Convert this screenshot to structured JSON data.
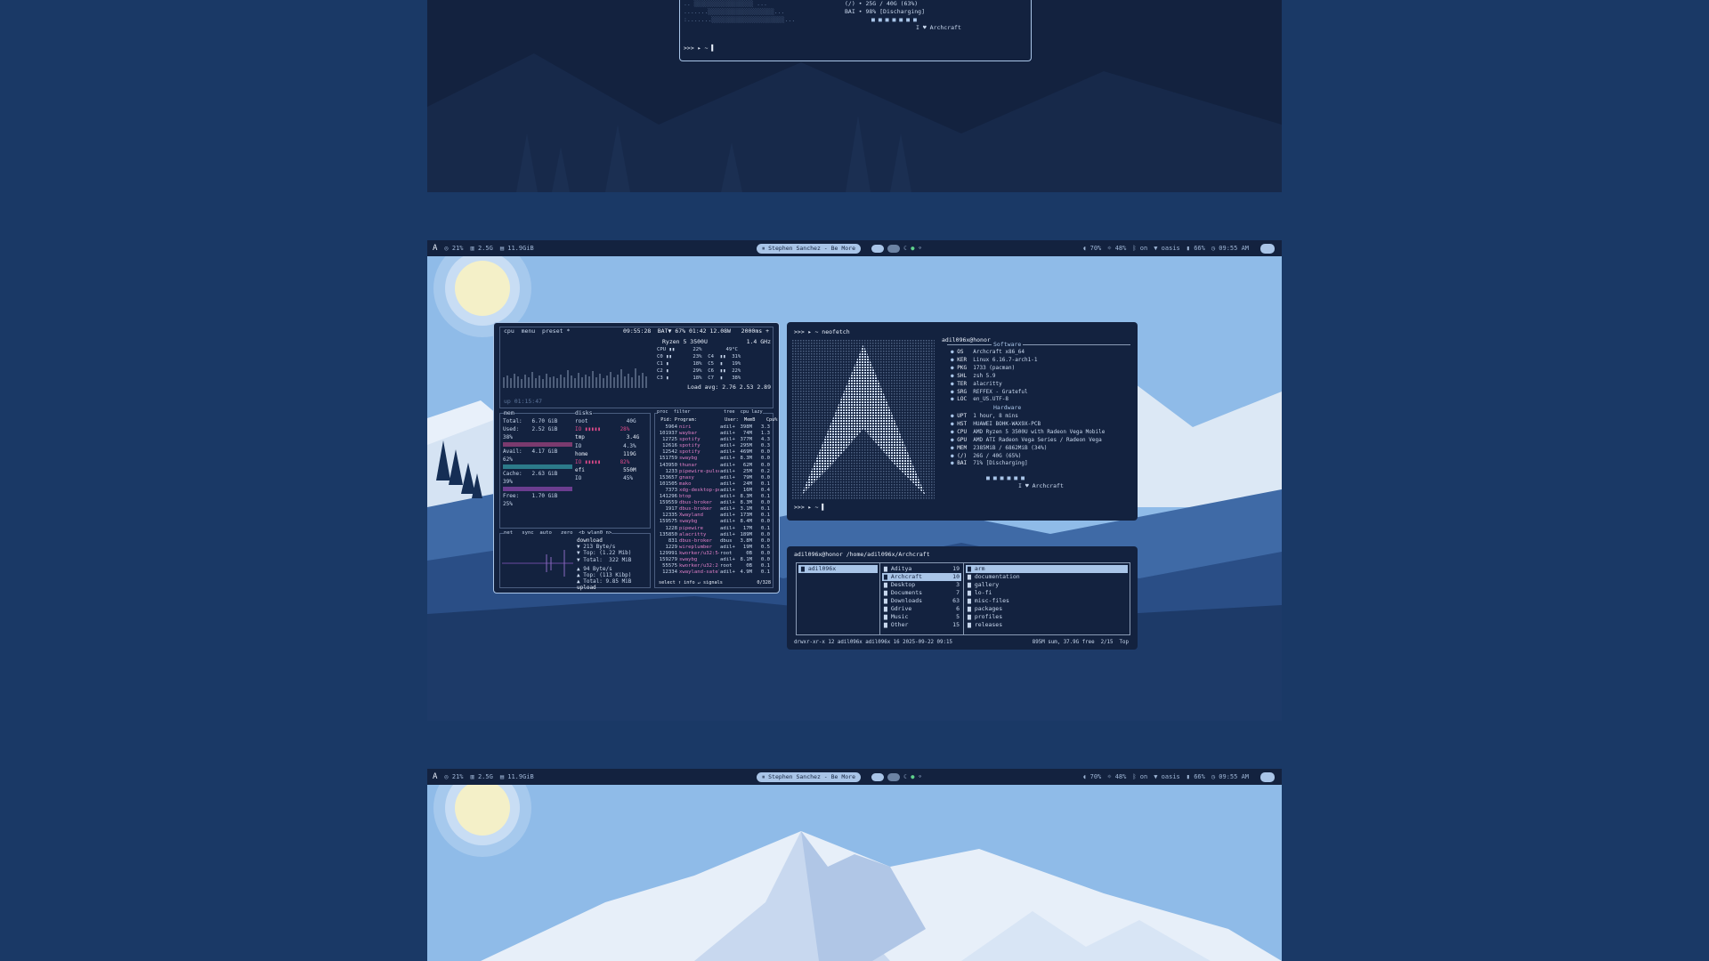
{
  "top_terminal": {
    "lines": [
      "(/) • 25G / 40G (63%)",
      "BAI • 98% [Discharging]",
      "I ♥ Archcraft"
    ],
    "prompt": ">>> ▸ ~ ▌"
  },
  "bar": {
    "logo": "A",
    "cpu": "21%",
    "disk": "2.5G",
    "mem": "11.9GiB",
    "media": "Stephen Sanchez - Be More",
    "volume": "70%",
    "brightness": "48%",
    "bluetooth": "on",
    "wifi": "oasis",
    "battery": "66%",
    "time": "09:55 AM"
  },
  "btop": {
    "header_left": "cpu  menu  preset *",
    "header_clock": "09:55:28",
    "header_right": "BAT▼ 67% 01:42 12.08W   2000ms +",
    "cpu_model": "Ryzen 5 3500U",
    "cpu_freq": "1.4 GHz",
    "cpu_lines": [
      "CPU ▮▮      22%        49°C",
      "C0 ▮▮       23%  C4  ▮▮  31%",
      "C1 ▮        18%  C5  ▮   19%",
      "C2 ▮        29%  C6  ▮▮  22%",
      "C3 ▮        18%  C7  ▮   38%"
    ],
    "load": "Load avg: 2.76 2.53 2.89",
    "uptime": "up 01:15:47",
    "mem_lines": [
      "Total:   6.70 GiB",
      "Used:    2.52 GiB",
      "38%",
      "Avail:   4.17 GiB",
      "62%",
      "Cache:   2.63 GiB",
      "39%",
      "Free:    1.70 GiB",
      "25%"
    ],
    "disk_lines": [
      "root            40G",
      "IO ▮▮▮▮▮      28%",
      "tmp             3.4G",
      "IO             4.3%",
      "home           119G",
      "IO ▮▮▮▮▮      82%",
      "efi            550M",
      "IO             45%"
    ],
    "net_lines": [
      "download",
      "▼ 213 Byte/s",
      "▼ Top: (1.22 Mib)",
      "▼ Total:  322 MiB",
      "▲ 94 Byte/s",
      "▲ Top: (113 Kibp)",
      "▲ Total: 9.85 MiB",
      "upload"
    ],
    "net_header": "net   sync  auto   zero  <b wlan0 n>",
    "proc_header": "proc  filter            tree  cpu lazy",
    "proc_cols": "  Pid: Program:          User:  MemB    Cpu%",
    "procs": [
      [
        "5964",
        "niri",
        "adil+",
        "398M",
        "3.3"
      ],
      [
        "101937",
        "waybar",
        "adil+",
        "74M",
        "1.3"
      ],
      [
        "12725",
        "spotify",
        "adil+",
        "377M",
        "4.3"
      ],
      [
        "12616",
        "spotify",
        "adil+",
        "295M",
        "0.3"
      ],
      [
        "12542",
        "spotify",
        "adil+",
        "469M",
        "0.0"
      ],
      [
        "151759",
        "swaybg",
        "adil+",
        "8.3M",
        "0.0"
      ],
      [
        "143950",
        "thunar",
        "adil+",
        "62M",
        "0.0"
      ],
      [
        "1233",
        "pipewire-pulse",
        "adil+",
        "25M",
        "0.2"
      ],
      [
        "153657",
        "gnasy",
        "adil+",
        "79M",
        "0.0"
      ],
      [
        "101505",
        "mako",
        "adil+",
        "24M",
        "0.1"
      ],
      [
        "7373",
        "xdg-desktop-por",
        "adil+",
        "16M",
        "0.4"
      ],
      [
        "141296",
        "btop",
        "adil+",
        "8.3M",
        "0.1"
      ],
      [
        "159559",
        "dbus-broker",
        "adil+",
        "8.3M",
        "0.0"
      ],
      [
        "1917",
        "dbus-broker",
        "adil+",
        "3.1M",
        "0.1"
      ],
      [
        "12335",
        "Xwayland",
        "adil+",
        "173M",
        "0.1"
      ],
      [
        "159575",
        "swaybg",
        "adil+",
        "8.4M",
        "0.0"
      ],
      [
        "1228",
        "pipewire",
        "adil+",
        "17M",
        "0.1"
      ],
      [
        "135850",
        "alacritty",
        "adil+",
        "189M",
        "0.0"
      ],
      [
        "831",
        "dbus-broker",
        "dbus",
        "3.8M",
        "0.0"
      ],
      [
        "1229",
        "wireplumber",
        "adil+",
        "19M",
        "0.5"
      ],
      [
        "129991",
        "kworker/u32:5+e",
        "root",
        "0B",
        "0.0"
      ],
      [
        "159279",
        "swaybg",
        "adil+",
        "8.1M",
        "0.0"
      ],
      [
        "55575",
        "kworker/u32:2-i",
        "root",
        "0B",
        "0.1"
      ],
      [
        "12334",
        "xwayland-satell",
        "adil+",
        "4.9M",
        "0.1"
      ]
    ],
    "footer": "select ↑ info ↵ signals",
    "count": "0/328"
  },
  "neofetch": {
    "prompt": ">>> ▸ ~ neofetch",
    "user_host": "adil096x@honor",
    "software_title": "Software",
    "software": [
      [
        "OS",
        "Archcraft x86_64"
      ],
      [
        "KER",
        "Linux 6.16.7-arch1-1"
      ],
      [
        "PKG",
        "1733 (pacman)"
      ],
      [
        "SHL",
        "zsh 5.9"
      ],
      [
        "TER",
        "alacritty"
      ],
      [
        "SRG",
        "REFFEX - Grateful"
      ],
      [
        "LOC",
        "en_US.UTF-8"
      ]
    ],
    "hardware_title": "Hardware",
    "hardware": [
      [
        "UPT",
        "1 hour, 8 mins"
      ],
      [
        "HST",
        "HUAWEI BOHK-WAX9X-PCB"
      ],
      [
        "CPU",
        "AMD Ryzen 5 3500U with Radeon Vega Mobile"
      ],
      [
        "GPU",
        "AMD ATI Radeon Vega Series / Radeon Vega"
      ],
      [
        "MEM",
        "2385MiB / 6862MiB (34%)"
      ],
      [
        "(/)",
        "26G / 40G (65%)"
      ],
      [
        "BAI",
        "71% [Discharging]"
      ]
    ],
    "footer": "I ♥ Archcraft",
    "prompt2": ">>> ▸ ~ ▌"
  },
  "ranger": {
    "path": "adil096x@honor /home/adil096x/Archcraft",
    "col1": [
      "adil096x"
    ],
    "col2": [
      [
        "Aditya",
        "19"
      ],
      [
        "Archcraft",
        "10"
      ],
      [
        "Desktop",
        "3"
      ],
      [
        "Documents",
        "7"
      ],
      [
        "Downloads",
        "63"
      ],
      [
        "Gdrive",
        "6"
      ],
      [
        "Music",
        "5"
      ],
      [
        "Other",
        "15"
      ]
    ],
    "col3": [
      "arm",
      "documentation",
      "gallery",
      "lo-fi",
      "misc-files",
      "packages",
      "profiles",
      "releases"
    ],
    "status_left": "drwxr-xr-x 12 adil096x adil096x 16 2025-09-22 09:15",
    "status_right": "895M sum, 37.9G free  2/15  Top"
  },
  "colors": {
    "bg": "#1a3966",
    "terminal": "#13223f",
    "accent": "#a9c5e8",
    "sky": "#8fbbe8"
  }
}
